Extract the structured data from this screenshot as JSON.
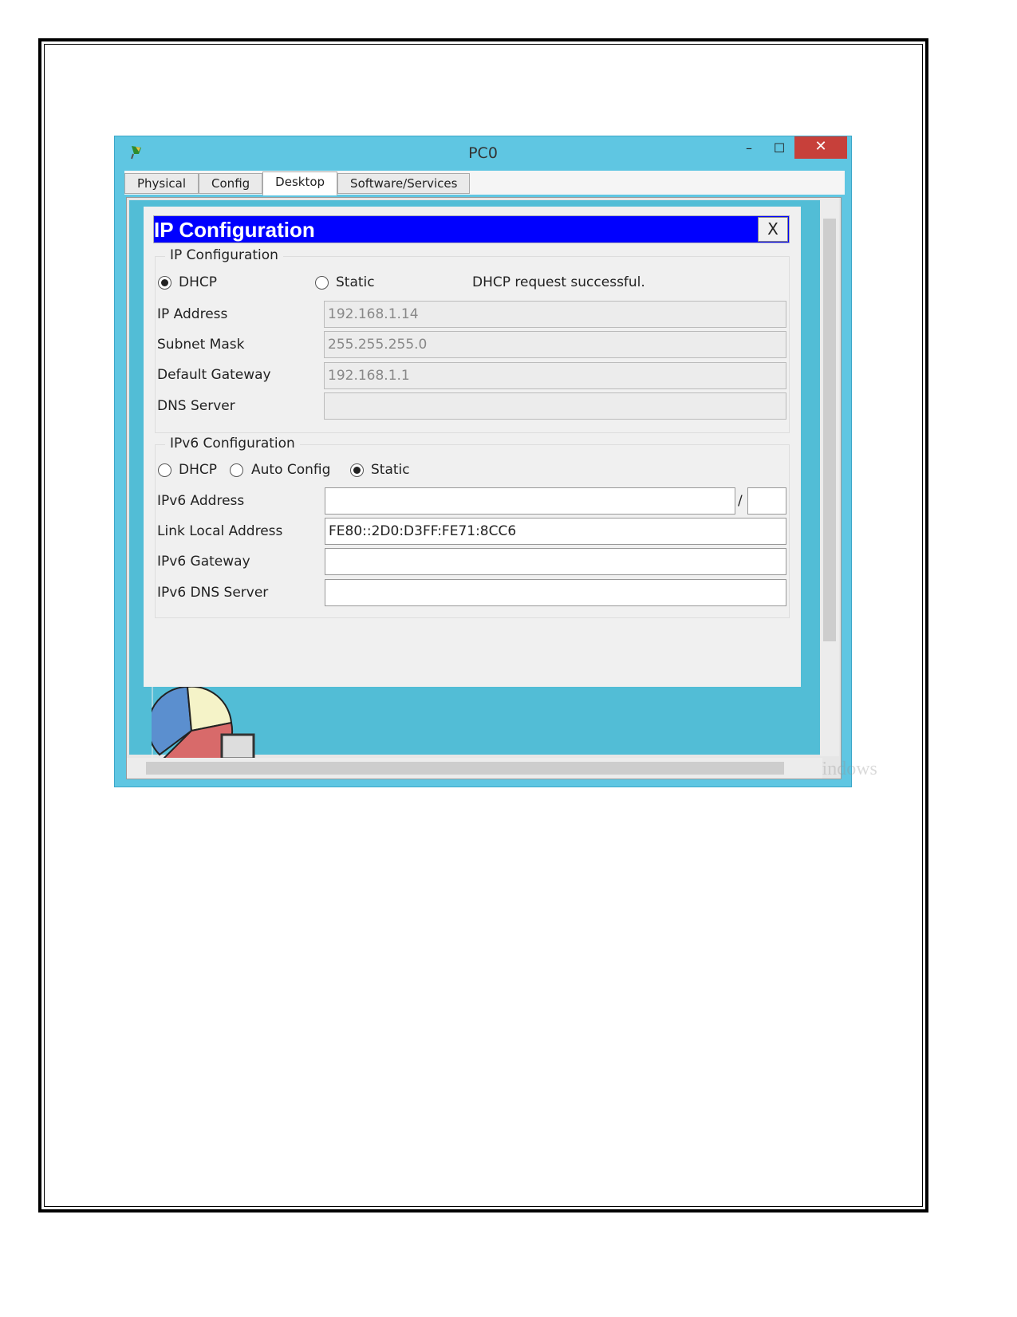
{
  "window": {
    "title": "PC0",
    "minimize": "–",
    "maximize": "☐",
    "close": "✕"
  },
  "tabs": [
    {
      "label": "Physical"
    },
    {
      "label": "Config"
    },
    {
      "label": "Desktop",
      "active": true
    },
    {
      "label": "Software/Services"
    }
  ],
  "dialog": {
    "title": "IP Configuration",
    "close": "X",
    "ipv4": {
      "legend": "IP Configuration",
      "mode_dhcp": "DHCP",
      "mode_static": "Static",
      "selected": "DHCP",
      "status": "DHCP request successful.",
      "ip_label": "IP Address",
      "ip": "192.168.1.14",
      "mask_label": "Subnet Mask",
      "mask": "255.255.255.0",
      "gw_label": "Default Gateway",
      "gw": "192.168.1.1",
      "dns_label": "DNS Server",
      "dns": ""
    },
    "ipv6": {
      "legend": "IPv6 Configuration",
      "mode_dhcp": "DHCP",
      "mode_auto": "Auto Config",
      "mode_static": "Static",
      "selected": "Static",
      "addr_label": "IPv6 Address",
      "addr": "",
      "slash": "/",
      "prefix": "",
      "lla_label": "Link Local Address",
      "lla": "FE80::2D0:D3FF:FE71:8CC6",
      "gw_label": "IPv6 Gateway",
      "gw": "",
      "dns_label": "IPv6 DNS Server",
      "dns": ""
    }
  },
  "watermark": "Activate Windows",
  "colors": {
    "titlebar": "#5fc6e2",
    "dialog_header": "#0000ff",
    "close_button": "#c7403a"
  }
}
